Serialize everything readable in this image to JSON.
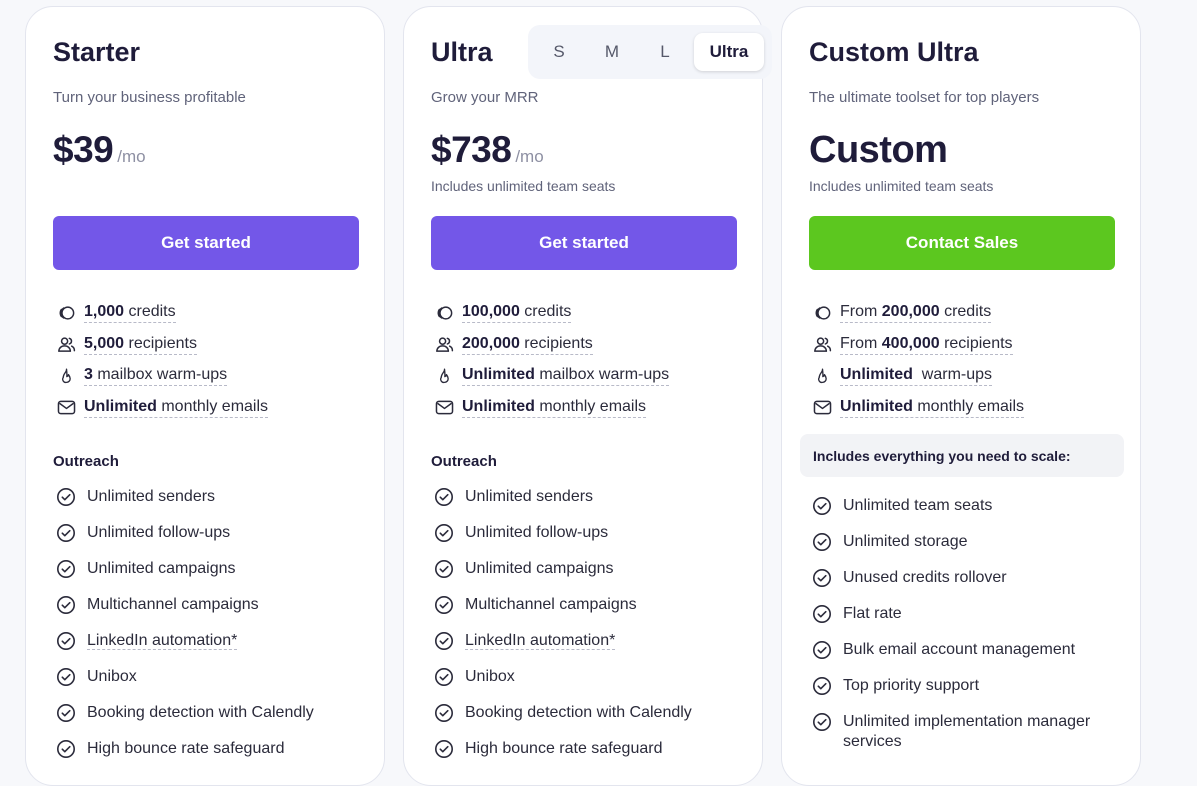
{
  "colors": {
    "primary_button": "#7357e8",
    "sales_button": "#5cc71f",
    "heading": "#1f1c3a",
    "muted": "#60637a"
  },
  "plans": [
    {
      "title": "Starter",
      "subtitle": "Turn your business profitable",
      "price": "$39",
      "period": "/mo",
      "cta": "Get started",
      "quotas": [
        {
          "icon": "coins-icon",
          "bold": "1,000",
          "text": " credits"
        },
        {
          "icon": "users-icon",
          "bold": "5,000",
          "text": " recipients"
        },
        {
          "icon": "flame-icon",
          "bold": "3",
          "text": " mailbox warm-ups"
        },
        {
          "icon": "mail-icon",
          "bold": "Unlimited",
          "text": " monthly emails"
        }
      ],
      "section": "Outreach",
      "features": [
        "Unlimited senders",
        "Unlimited follow-ups",
        "Unlimited campaigns",
        "Multichannel campaigns",
        "LinkedIn automation*",
        "Unibox",
        "Booking detection with Calendly",
        "High bounce rate safeguard"
      ]
    },
    {
      "title": "Ultra",
      "subtitle": "Grow your MRR",
      "price": "$738",
      "period": "/mo",
      "seats": "Includes unlimited team seats",
      "cta": "Get started",
      "size_options": [
        "S",
        "M",
        "L",
        "Ultra"
      ],
      "size_selected": "Ultra",
      "quotas": [
        {
          "icon": "coins-icon",
          "bold": "100,000",
          "text": " credits"
        },
        {
          "icon": "users-icon",
          "bold": "200,000",
          "text": " recipients"
        },
        {
          "icon": "flame-icon",
          "bold": "Unlimited",
          "text": " mailbox warm-ups"
        },
        {
          "icon": "mail-icon",
          "bold": "Unlimited",
          "text": " monthly emails"
        }
      ],
      "section": "Outreach",
      "features": [
        "Unlimited senders",
        "Unlimited follow-ups",
        "Unlimited campaigns",
        "Multichannel campaigns",
        "LinkedIn automation*",
        "Unibox",
        "Booking detection with Calendly",
        "High bounce rate safeguard"
      ]
    },
    {
      "title": "Custom Ultra",
      "subtitle": "The ultimate toolset for top players",
      "price": "Custom",
      "seats": "Includes unlimited team seats",
      "cta": "Contact Sales",
      "quotas": [
        {
          "icon": "coins-icon",
          "prefix": "From ",
          "bold": "200,000",
          "text": " credits"
        },
        {
          "icon": "users-icon",
          "prefix": "From ",
          "bold": "400,000",
          "text": " recipients"
        },
        {
          "icon": "flame-icon",
          "bold": "Unlimited",
          "text": "  warm-ups"
        },
        {
          "icon": "mail-icon",
          "bold": "Unlimited",
          "text": " monthly emails"
        }
      ],
      "banner": "Includes everything you need to scale:",
      "features": [
        "Unlimited team seats",
        "Unlimited storage",
        "Unused credits rollover",
        "Flat rate",
        "Bulk email account management",
        "Top priority support",
        "Unlimited implementation manager services"
      ]
    }
  ]
}
